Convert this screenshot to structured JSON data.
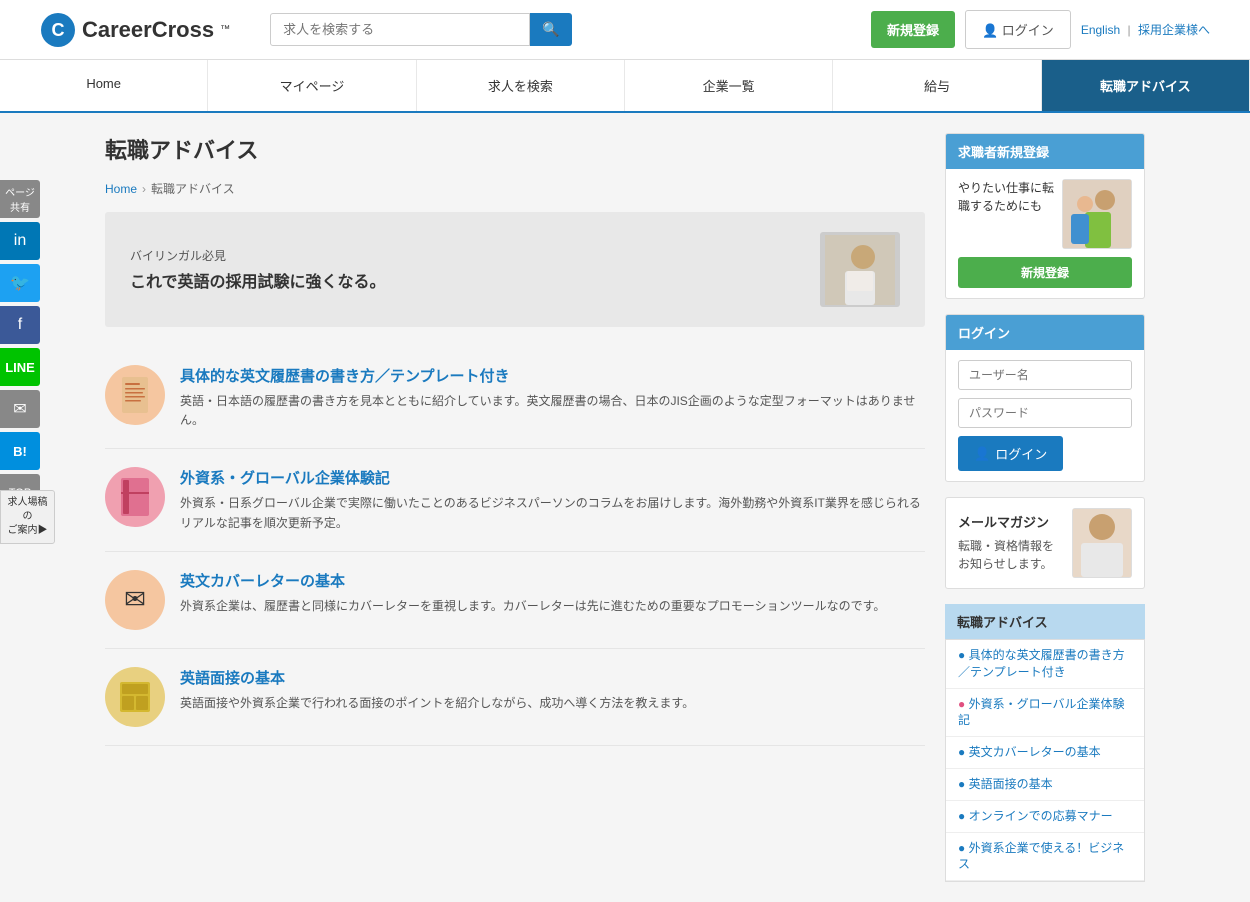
{
  "header": {
    "logo_text": "CareerCross",
    "logo_tm": "™",
    "search_placeholder": "求人を検索する",
    "signup_label": "新規登録",
    "login_label": "ログイン",
    "lang_english": "English",
    "lang_sep": "|",
    "lang_employer": "採用企業様へ"
  },
  "nav": {
    "items": [
      {
        "label": "Home",
        "active": false
      },
      {
        "label": "マイページ",
        "active": false
      },
      {
        "label": "求人を検索",
        "active": false
      },
      {
        "label": "企業一覧",
        "active": false
      },
      {
        "label": "給与",
        "active": false
      },
      {
        "label": "転職アドバイス",
        "active": true
      }
    ]
  },
  "page": {
    "title": "転職アドバイス",
    "breadcrumb": {
      "home": "Home",
      "current": "転職アドバイス"
    }
  },
  "banner": {
    "sub": "バイリンガル必見",
    "main": "これで英語の採用試験に強くなる。"
  },
  "articles": [
    {
      "id": "resume",
      "title": "具体的な英文履歴書の書き方／テンプレート付き",
      "desc": "英語・日本語の履歴書の書き方を見本とともに紹介しています。英文履歴書の場合、日本のJIS企画のような定型フォーマットはありません。",
      "icon": "📄",
      "icon_class": "resume"
    },
    {
      "id": "global",
      "title": "外資系・グローバル企業体験記",
      "desc": "外資系・日系グローバル企業で実際に働いたことのあるビジネスパーソンのコラムをお届けします。海外勤務や外資系IT業界を感じられるリアルな記事を順次更新予定。",
      "icon": "📕",
      "icon_class": "global"
    },
    {
      "id": "cover",
      "title": "英文カバーレターの基本",
      "desc": "外資系企業は、履歴書と同様にカバーレターを重視します。カバーレターは先に進むための重要なプロモーションツールなのです。",
      "icon": "✉",
      "icon_class": "cover"
    },
    {
      "id": "interview",
      "title": "英語面接の基本",
      "desc": "英語面接や外資系企業で行われる面接のポイントを紹介しながら、成功へ導く方法を教えます。",
      "icon": "🏢",
      "icon_class": "interview"
    }
  ],
  "social": {
    "share_label": "ページ共有",
    "top_label": "TOP",
    "job_banner": "求人場稿の\nご案内▶"
  },
  "sidebar": {
    "signup_card": {
      "title": "求職者新規登録",
      "text": "やりたい仕事に転職するためにも",
      "btn": "新規登録"
    },
    "login_card": {
      "title": "ログイン",
      "username_placeholder": "ユーザー名",
      "password_placeholder": "パスワード",
      "login_btn": "ログイン"
    },
    "mail_card": {
      "title": "メールマガジン",
      "text": "転職・資格情報をお知らせします。"
    },
    "advice_nav": {
      "title": "転職アドバイス",
      "items": [
        {
          "label": "具体的な英文履歴書の書き方／テンプレート付き",
          "dot": "blue"
        },
        {
          "label": "外資系・グローバル企業体験記",
          "dot": "pink"
        },
        {
          "label": "英文カバーレターの基本",
          "dot": "blue"
        },
        {
          "label": "英語面接の基本",
          "dot": "blue"
        },
        {
          "label": "オンラインでの応募マナー",
          "dot": "blue"
        },
        {
          "label": "外資系企業で使える！ビジネス",
          "dot": "blue"
        }
      ]
    }
  }
}
